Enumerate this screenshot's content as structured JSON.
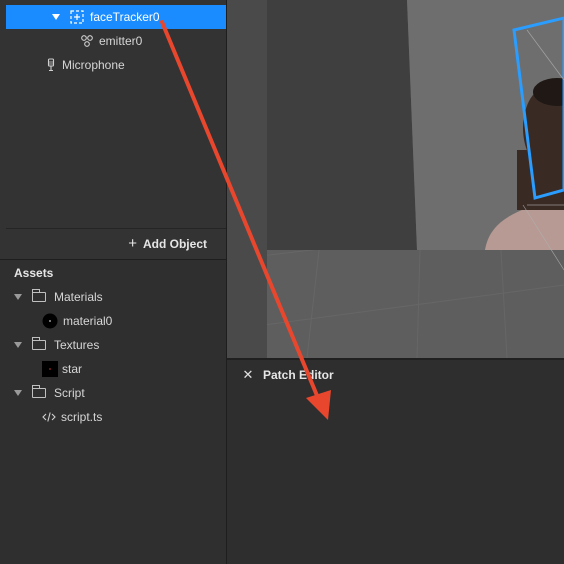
{
  "scene": {
    "items": [
      {
        "label": "faceTracker0",
        "selected": true,
        "icon": "face-tracker-icon"
      },
      {
        "label": "emitter0",
        "selected": false,
        "icon": "emitter-icon"
      },
      {
        "label": "Microphone",
        "selected": false,
        "icon": "microphone-icon"
      }
    ],
    "add_object_label": "Add Object"
  },
  "assets": {
    "title": "Assets",
    "folders": [
      {
        "label": "Materials",
        "children": [
          {
            "label": "material0",
            "icon": "material-icon"
          }
        ]
      },
      {
        "label": "Textures",
        "children": [
          {
            "label": "star",
            "icon": "texture-thumbnail"
          }
        ]
      },
      {
        "label": "Script",
        "children": [
          {
            "label": "script.ts",
            "icon": "code-icon"
          }
        ]
      }
    ]
  },
  "patch_editor": {
    "title": "Patch Editor"
  },
  "colors": {
    "selection": "#1a8cff",
    "annotation_arrow": "#e8472e",
    "face_tracker_outline": "#2a9dff"
  }
}
